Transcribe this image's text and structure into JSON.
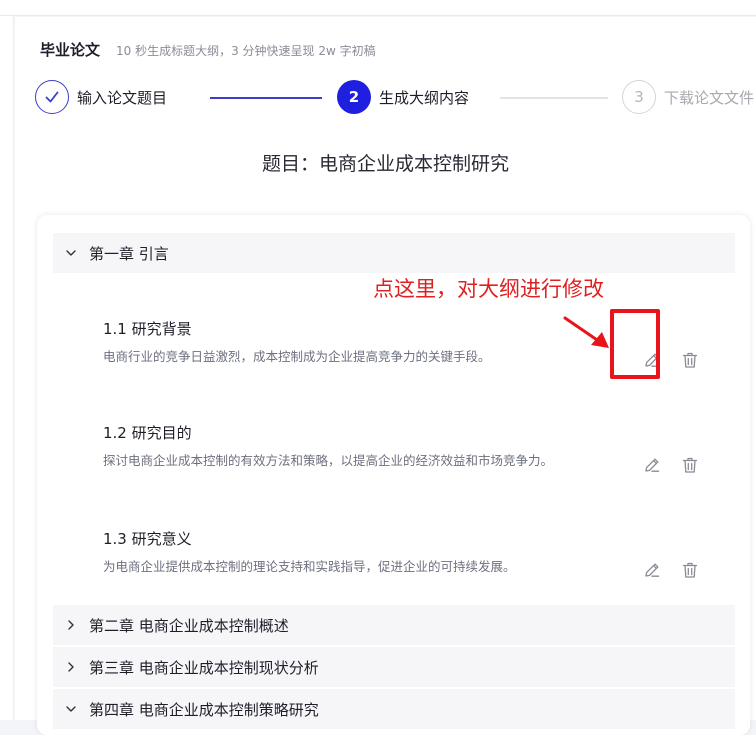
{
  "header": {
    "title": "毕业论文",
    "subtitle": "10 秒生成标题大纲，3 分钟快速呈现 2w 字初稿"
  },
  "steps": [
    {
      "number": "✓",
      "label": "输入论文题目",
      "state": "done"
    },
    {
      "number": "2",
      "label": "生成大纲内容",
      "state": "active"
    },
    {
      "number": "3",
      "label": "下载论文文件",
      "state": "pending"
    }
  ],
  "topic": "题目：电商企业成本控制研究",
  "outline": {
    "chapters": [
      {
        "title": "第一章 引言",
        "expanded": true,
        "sections": [
          {
            "title": "1.1 研究背景",
            "desc": "电商行业的竞争日益激烈，成本控制成为企业提高竞争力的关键手段。"
          },
          {
            "title": "1.2 研究目的",
            "desc": "探讨电商企业成本控制的有效方法和策略，以提高企业的经济效益和市场竞争力。"
          },
          {
            "title": "1.3 研究意义",
            "desc": "为电商企业提供成本控制的理论支持和实践指导，促进企业的可持续发展。"
          }
        ]
      },
      {
        "title": "第二章 电商企业成本控制概述",
        "expanded": false
      },
      {
        "title": "第三章 电商企业成本控制现状分析",
        "expanded": false
      },
      {
        "title": "第四章 电商企业成本控制策略研究",
        "expanded": true
      }
    ]
  },
  "annotation": {
    "text": "点这里，对大纲进行修改",
    "color": "#e02020"
  },
  "colors": {
    "accent": "#1f1fe0",
    "done": "#3b3ec8",
    "muted": "#a8a8b0"
  }
}
